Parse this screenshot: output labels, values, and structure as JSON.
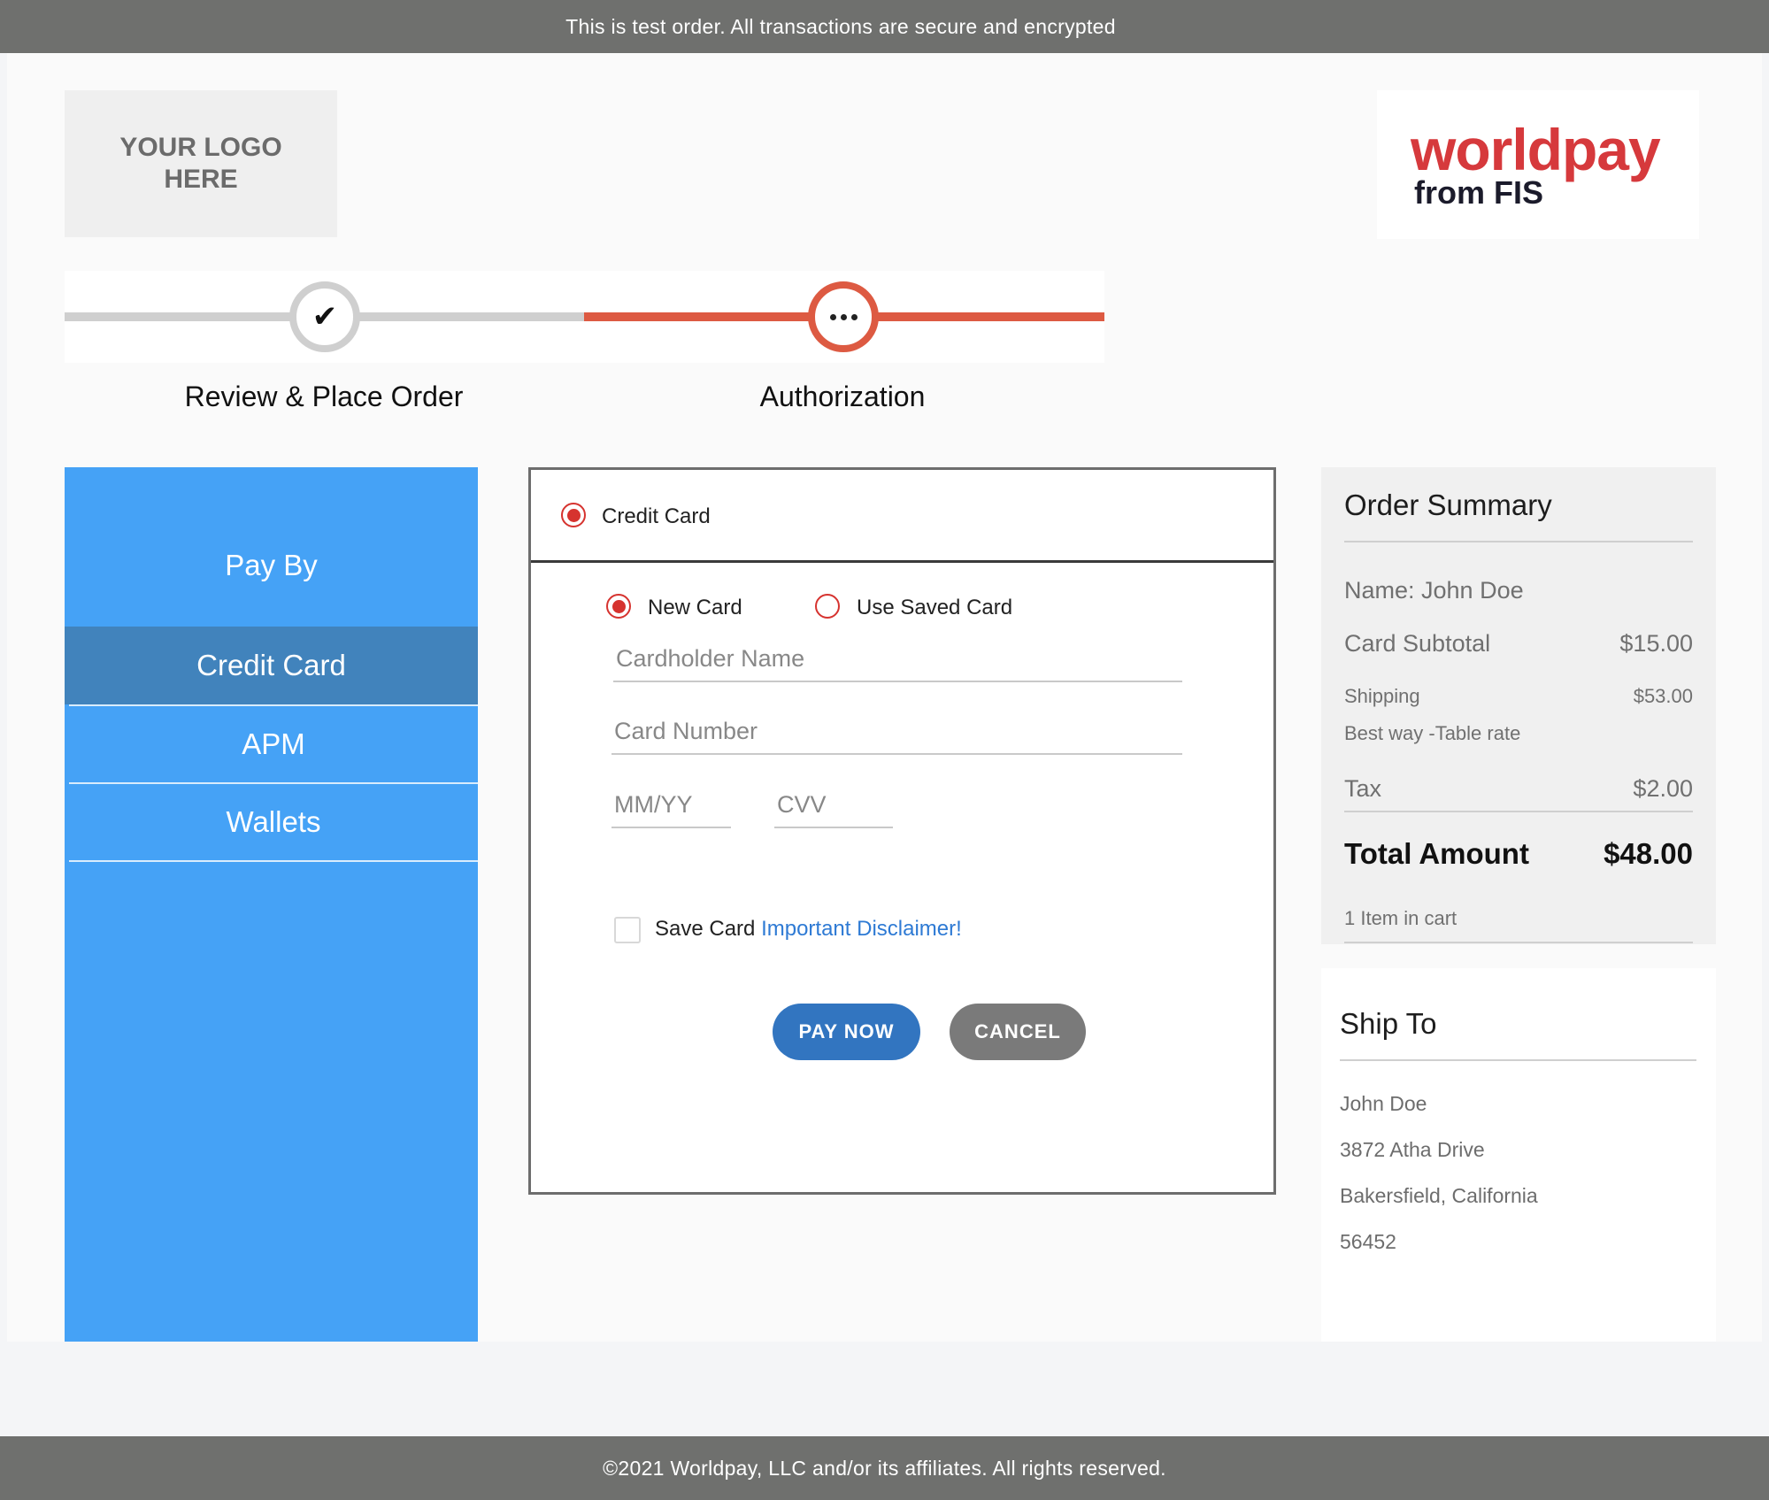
{
  "banner": {
    "text": "This is test order. All transactions are secure and encrypted"
  },
  "logo_placeholder": {
    "text": "YOUR LOGO HERE"
  },
  "brand_logo": {
    "word": "worldpay",
    "sub": "from FIS"
  },
  "stepper": {
    "steps": [
      {
        "label": "Review & Place Order",
        "status": "complete",
        "icon": "check-icon"
      },
      {
        "label": "Authorization",
        "status": "current",
        "icon": "ellipsis-icon"
      }
    ]
  },
  "sidebar": {
    "title": "Pay By",
    "items": [
      {
        "label": "Credit Card",
        "active": true
      },
      {
        "label": "APM",
        "active": false
      },
      {
        "label": "Wallets",
        "active": false
      }
    ]
  },
  "payment_form": {
    "method_label": "Credit Card",
    "card_options": [
      {
        "label": "New Card",
        "selected": true
      },
      {
        "label": "Use Saved Card",
        "selected": false
      }
    ],
    "fields": {
      "cardholder_placeholder": "Cardholder Name",
      "card_number_placeholder": "Card Number",
      "expiry_placeholder": "MM/YY",
      "cvv_placeholder": "CVV"
    },
    "save_card_label": "Save Card",
    "save_card_checked": false,
    "disclaimer_link": "Important Disclaimer!",
    "pay_now_label": "PAY NOW",
    "cancel_label": "CANCEL"
  },
  "order_summary": {
    "title": "Order Summary",
    "name_line": "Name: John Doe",
    "card_subtotal_label": "Card Subtotal",
    "card_subtotal_value": "$15.00",
    "shipping_label": "Shipping",
    "shipping_value": "$53.00",
    "shipping_method": "Best way -Table rate",
    "tax_label": "Tax",
    "tax_value": "$2.00",
    "total_label": "Total Amount",
    "total_value": "$48.00",
    "items_in_cart": "1 Item in cart"
  },
  "ship_to": {
    "title": "Ship To",
    "name": "John Doe",
    "street": "3872 Atha Drive",
    "city_state": "Bakersfield, California",
    "zip": "56452"
  },
  "footer": {
    "text": "©2021 Worldpay, LLC and/or its affiliates. All rights reserved."
  },
  "colors": {
    "banner_bg": "#6f706e",
    "sidebar_bg": "#45a2f6",
    "sidebar_active_bg": "#4183bc",
    "accent_red": "#dd5a42",
    "pay_button": "#3275c0",
    "cancel_button": "#7a7a7a",
    "link": "#2e7ad4"
  }
}
